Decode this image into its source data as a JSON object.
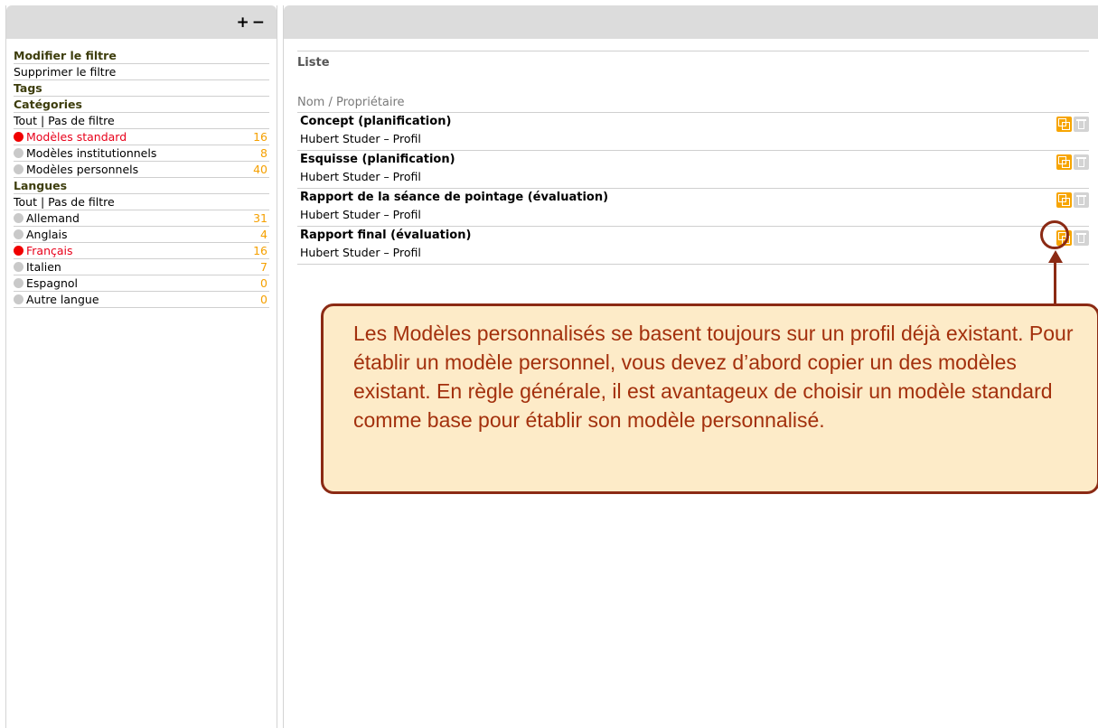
{
  "left_panel": {
    "zoom": {
      "plus": "+",
      "minus": "−"
    },
    "filters": [
      {
        "type": "heading",
        "label": "Modifier le filtre"
      },
      {
        "type": "link",
        "label": "Supprimer le filtre"
      },
      {
        "type": "heading",
        "label": "Tags"
      },
      {
        "type": "heading",
        "label": "Catégories",
        "noline": true
      },
      {
        "type": "link",
        "label": "Tout | Pas de filtre"
      },
      {
        "type": "item",
        "label": "Modèles standard",
        "count": "16",
        "selected": true
      },
      {
        "type": "item",
        "label": "Modèles institutionnels",
        "count": "8"
      },
      {
        "type": "item",
        "label": "Modèles personnels",
        "count": "40"
      },
      {
        "type": "heading",
        "label": "Langues",
        "noline": true
      },
      {
        "type": "link",
        "label": "Tout | Pas de filtre"
      },
      {
        "type": "item",
        "label": "Allemand",
        "count": "31"
      },
      {
        "type": "item",
        "label": "Anglais",
        "count": "4"
      },
      {
        "type": "item",
        "label": "Français",
        "count": "16",
        "selected": true
      },
      {
        "type": "item",
        "label": "Italien",
        "count": "7"
      },
      {
        "type": "item",
        "label": "Espagnol",
        "count": "0"
      },
      {
        "type": "item",
        "label": "Autre langue",
        "count": "0"
      }
    ]
  },
  "main": {
    "list_title": "Liste",
    "column_header": "Nom / Propriétaire",
    "rows": [
      {
        "title": "Concept (planification)",
        "owner": "Hubert Studer – Profil"
      },
      {
        "title": "Esquisse (planification)",
        "owner": "Hubert Studer – Profil"
      },
      {
        "title": "Rapport de la séance de pointage (évaluation)",
        "owner": "Hubert Studer – Profil"
      },
      {
        "title": "Rapport final (évaluation)",
        "owner": "Hubert Studer – Profil"
      }
    ]
  },
  "callout": {
    "text": "Les Modèles personnalisés se basent toujours sur un profil déjà existant. Pour établir un modèle personnel, vous devez d’abord copier un des modèles existant. En règle générale, il est avantageux de choisir un modèle standard comme base pour établir son modèle personnalisé."
  },
  "colors": {
    "accent_orange": "#f7a500",
    "selected_red": "#e8001a",
    "callout_border": "#8b2a14",
    "callout_bg": "#fdebc8",
    "callout_text": "#a3300d"
  }
}
